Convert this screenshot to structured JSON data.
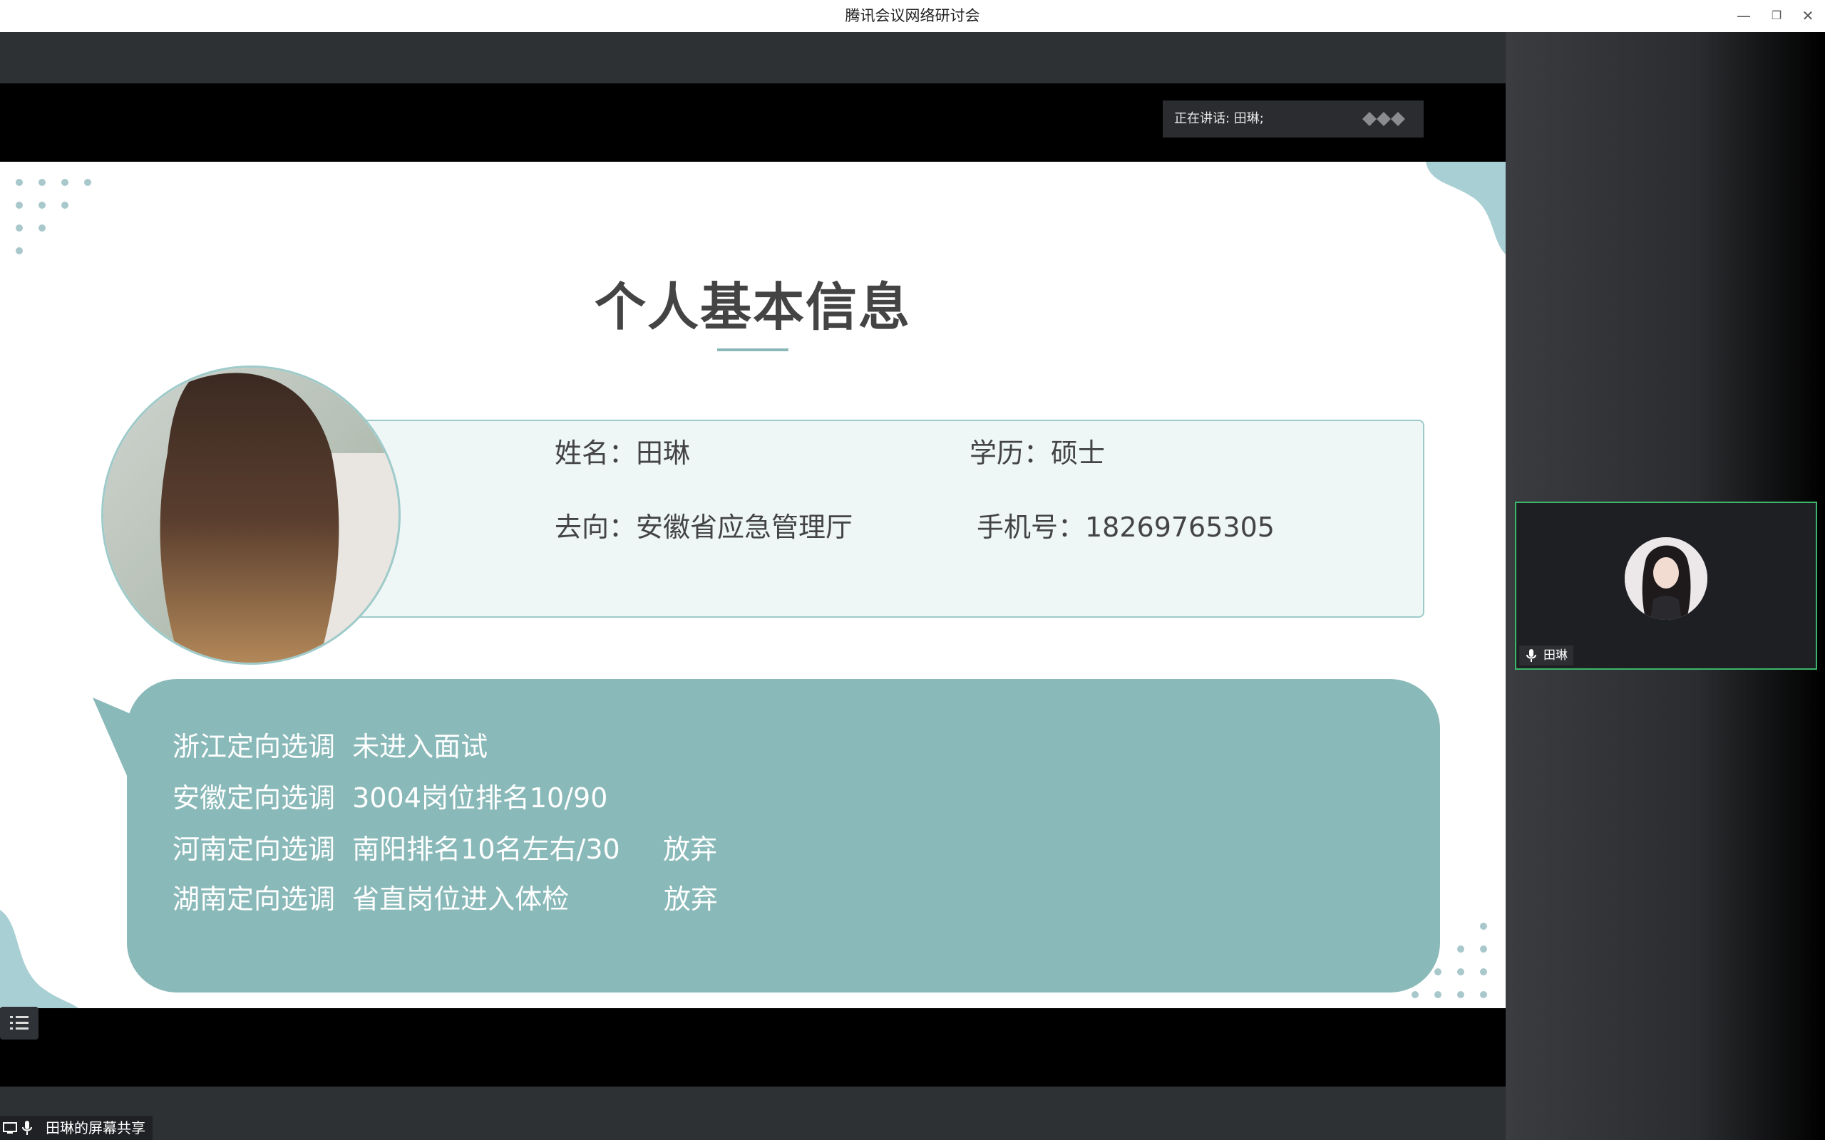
{
  "window": {
    "title": "腾讯会议网络研讨会",
    "minimize_icon": "minimize-icon",
    "restore_icon": "restore-icon",
    "close_icon": "close-icon"
  },
  "speaking": {
    "label": "正在讲话: 田琳;"
  },
  "slide": {
    "title": "个人基本信息",
    "name": "姓名：田琳",
    "education": "学历：硕士",
    "destination": "去向：安徽省应急管理厅",
    "phone": "手机号：18269765305",
    "lines": [
      "浙江定向选调  未进入面试",
      "安徽定向选调  3004岗位排名10/90",
      "河南定向选调  南阳排名10名左右/30     放弃",
      "湖南定向选调  省直岗位进入体检           放弃"
    ]
  },
  "share_status": {
    "label": "田琳的屏幕共享"
  },
  "participant": {
    "name": "田琳"
  },
  "colors": {
    "accent_teal": "#8ab9b9",
    "tile_border": "#3db56b"
  }
}
